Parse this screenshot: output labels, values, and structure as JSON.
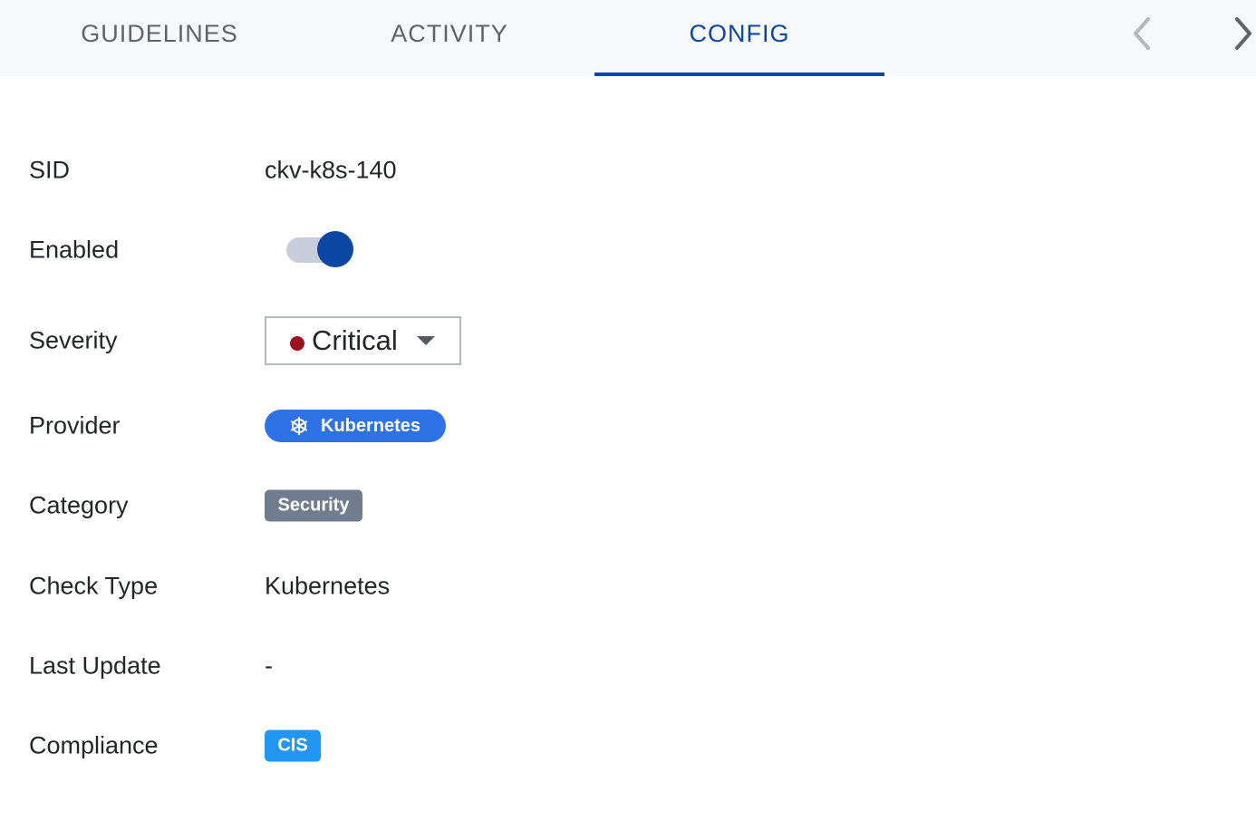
{
  "tabs": [
    {
      "label": "GUIDELINES",
      "active": false
    },
    {
      "label": "ACTIVITY",
      "active": false
    },
    {
      "label": "CONFIG",
      "active": true
    }
  ],
  "nav": {
    "prev_icon": "chevron-left-icon",
    "next_icon": "chevron-right-icon"
  },
  "fields": {
    "sid": {
      "label": "SID",
      "value": "ckv-k8s-140"
    },
    "enabled": {
      "label": "Enabled",
      "value": true
    },
    "severity": {
      "label": "Severity",
      "value": "Critical",
      "color": "#9b0f1f"
    },
    "provider": {
      "label": "Provider",
      "value": "Kubernetes",
      "icon": "kubernetes-icon",
      "color": "#2f72e6"
    },
    "category": {
      "label": "Category",
      "value": "Security",
      "color": "#717c8f"
    },
    "check_type": {
      "label": "Check Type",
      "value": "Kubernetes"
    },
    "last_update": {
      "label": "Last Update",
      "value": "-"
    },
    "compliance": {
      "label": "Compliance",
      "value": "CIS",
      "color": "#2196f3"
    }
  },
  "colors": {
    "accent": "#0b47a3",
    "tabbar_bg": "#f6f8fc",
    "toggle_track": "#c9ccdb"
  }
}
